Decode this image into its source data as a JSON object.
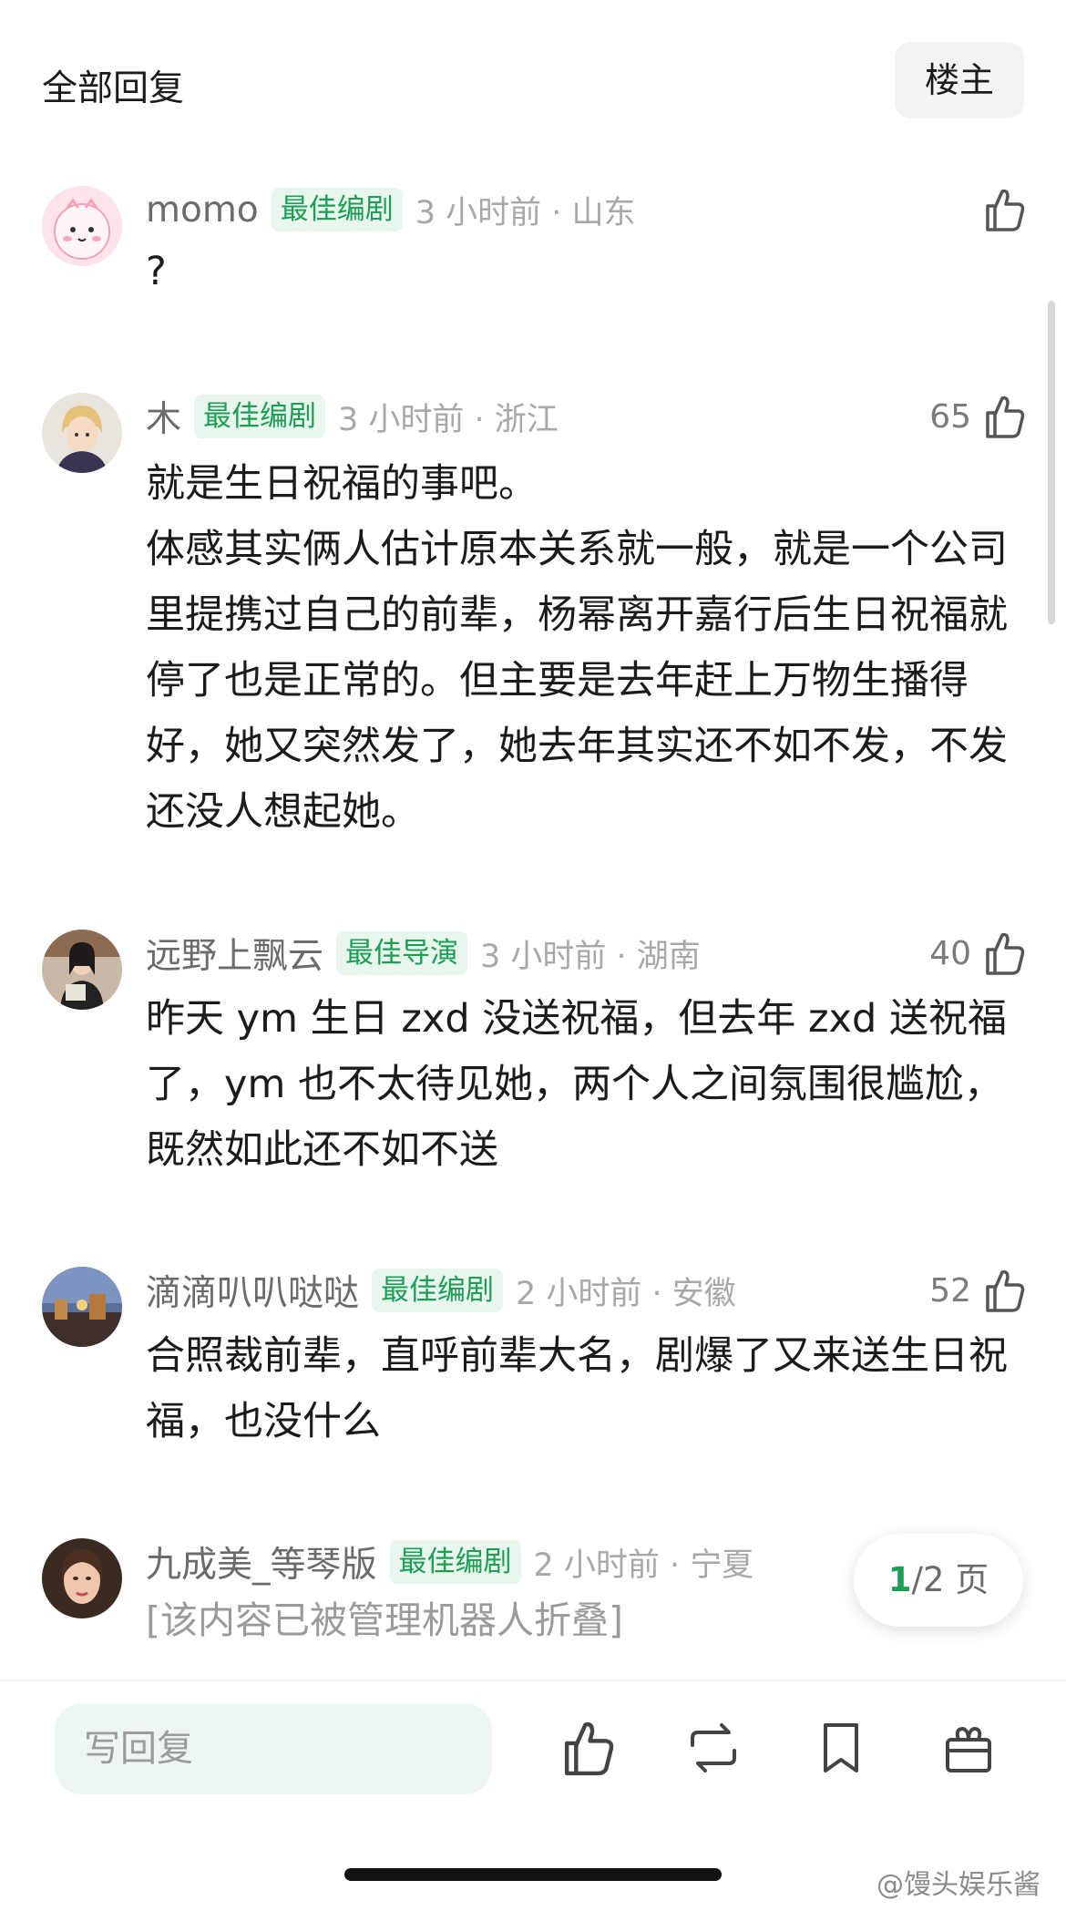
{
  "header": {
    "title": "全部回复",
    "op_label": "楼主"
  },
  "comments": [
    {
      "username": "momo",
      "badge": "最佳编剧",
      "time": "3 小时前 · 山东",
      "likes": "",
      "text": [
        "?"
      ]
    },
    {
      "username": "木",
      "badge": "最佳编剧",
      "time": "3 小时前 · 浙江",
      "likes": "65",
      "text": [
        "就是生日祝福的事吧。",
        "体感其实俩人估计原本关系就一般，就是一个公司里提携过自己的前辈，杨幂离开嘉行后生日祝福就停了也是正常的。但主要是去年赶上万物生播得好，她又突然发了，她去年其实还不如不发，不发还没人想起她。"
      ]
    },
    {
      "username": "远野上飘云",
      "badge": "最佳导演",
      "time": "3 小时前 · 湖南",
      "likes": "40",
      "text": [
        "昨天 ym 生日 zxd 没送祝福，但去年 zxd 送祝福了，ym 也不太待见她，两个人之间氛围很尴尬，既然如此还不如不送"
      ]
    },
    {
      "username": "滴滴叭叭哒哒",
      "badge": "最佳编剧",
      "time": "2 小时前 · 安徽",
      "likes": "52",
      "text": [
        "合照裁前辈，直呼前辈大名，剧爆了又来送生日祝福，也没什么"
      ]
    },
    {
      "username": "九成美_等琴版",
      "badge": "最佳编剧",
      "time": "2 小时前 · 宁夏",
      "likes": "",
      "text": [
        "[该内容已被管理机器人折叠]"
      ]
    }
  ],
  "pagination": {
    "current": "1",
    "total": "/2 页"
  },
  "bottom_bar": {
    "reply_placeholder": "写回复",
    "icons": [
      "thumbs-up-icon",
      "repost-icon",
      "bookmark-icon",
      "gift-icon"
    ]
  },
  "watermark": "@馒头娱乐酱",
  "colors": {
    "accent": "#1d9e55",
    "badge_bg": "#e9f6ee"
  }
}
